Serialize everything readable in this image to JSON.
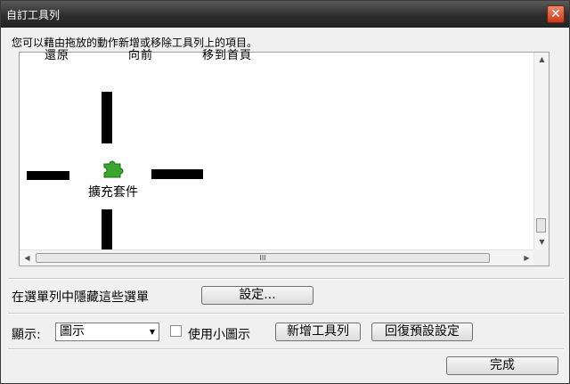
{
  "window": {
    "title": "自訂工具列",
    "close_symbol": "✕"
  },
  "instruction": "您可以藉由拖放的動作新增或移除工具列上的項目。",
  "toolbar_area": {
    "cut_texts": [
      "還原",
      "向前",
      "移到首頁"
    ],
    "extension_item": {
      "label": "擴充套件",
      "icon": "puzzle-piece-icon",
      "color": "#3aa62f"
    }
  },
  "scroll": {
    "up": "▲",
    "down": "▼",
    "left": "◀",
    "right": "▶",
    "grip": "III"
  },
  "menu_row": {
    "label": "在選單列中隱藏這些選單",
    "settings_button": "設定..."
  },
  "display_row": {
    "label": "顯示:",
    "select_value": "圖示",
    "small_icons_label": "使用小圖示",
    "small_icons_checked": false,
    "add_toolbar_button": "新增工具列",
    "restore_defaults_button": "回復預設設定"
  },
  "done_button": "完成"
}
